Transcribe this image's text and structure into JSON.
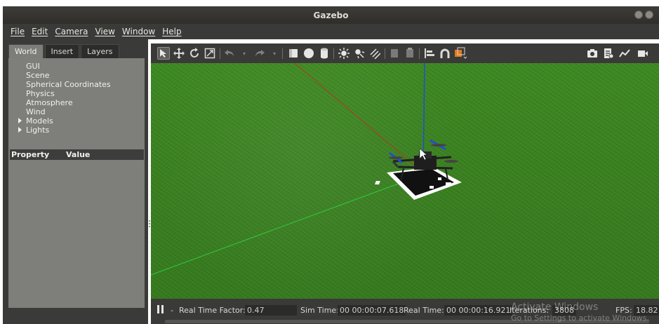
{
  "window": {
    "title": "Gazebo"
  },
  "menubar": {
    "items": [
      "File",
      "Edit",
      "Camera",
      "View",
      "Window",
      "Help"
    ]
  },
  "left_panel": {
    "tabs": [
      {
        "label": "World",
        "active": true
      },
      {
        "label": "Insert",
        "active": false
      },
      {
        "label": "Layers",
        "active": false
      }
    ],
    "tree": [
      "GUI",
      "Scene",
      "Spherical Coordinates",
      "Physics",
      "Atmosphere",
      "Wind"
    ],
    "tree_expandable": [
      "Models",
      "Lights"
    ],
    "property_header": {
      "property": "Property",
      "value": "Value"
    }
  },
  "toolbar": {
    "icons": [
      "select-arrow-icon",
      "translate-icon",
      "rotate-icon",
      "scale-icon",
      "undo-icon",
      "undo-dropdown-icon",
      "redo-icon",
      "redo-dropdown-icon",
      "box-icon",
      "sphere-icon",
      "cylinder-icon",
      "point-light-icon",
      "spot-light-icon",
      "directional-light-icon",
      "copy-icon",
      "paste-icon",
      "align-icon",
      "snap-icon",
      "view-angle-icon",
      "screenshot-icon",
      "log-icon",
      "plot-icon",
      "video-icon"
    ]
  },
  "status": {
    "real_time_factor_label": "Real Time Factor:",
    "real_time_factor": "0.47",
    "sim_time_label": "Sim Time:",
    "sim_time": "00 00:00:07.618",
    "real_time_label": "Real Time:",
    "real_time": "00 00:00:16.921",
    "iterations_label": "Iterations:",
    "iterations": "3808",
    "fps_label": "FPS:",
    "fps": "18.82"
  },
  "watermark": {
    "line1": "Activate Windows",
    "line2": "Go to Settings to activate Windows."
  },
  "colors": {
    "grass": "#3a8120",
    "panel": "#3a3a38",
    "tree_bg": "#7e7e7b",
    "x_axis": "#c0392b",
    "y_axis": "#2ecc40",
    "z_axis": "#1f4fd6"
  }
}
